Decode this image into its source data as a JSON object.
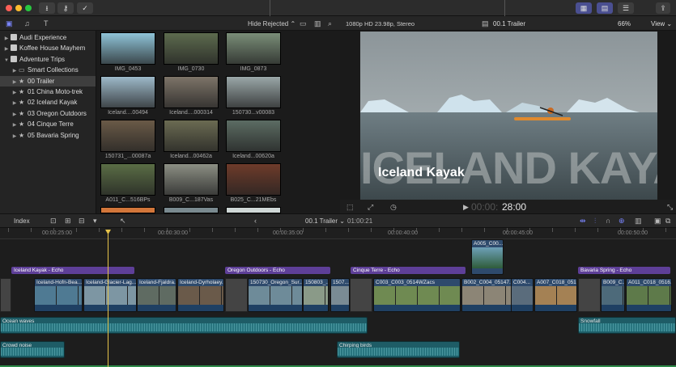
{
  "window": {
    "traffic": [
      "close",
      "minimize",
      "zoom"
    ]
  },
  "toolbar": {
    "hide_rejected": "Hide Rejected ⌃",
    "format": "1080p HD 23.98p, Stereo",
    "clip_name": "00.1 Trailer",
    "zoom": "66%",
    "view": "View ⌄"
  },
  "libraries": [
    {
      "label": "Audi Experience",
      "kind": "lib",
      "indent": 0
    },
    {
      "label": "Koffee House Mayhem",
      "kind": "lib",
      "indent": 0
    },
    {
      "label": "Adventure Trips",
      "kind": "lib",
      "indent": 0,
      "open": true
    },
    {
      "label": "Smart Collections",
      "kind": "folder",
      "indent": 1
    },
    {
      "label": "00 Trailer",
      "kind": "event",
      "indent": 1,
      "selected": true
    },
    {
      "label": "01 China Moto-trek",
      "kind": "event",
      "indent": 1
    },
    {
      "label": "02 Iceland Kayak",
      "kind": "event",
      "indent": 1
    },
    {
      "label": "03 Oregon Outdoors",
      "kind": "event",
      "indent": 1
    },
    {
      "label": "04 Cinque Terre",
      "kind": "event",
      "indent": 1
    },
    {
      "label": "05 Bavaria Spring",
      "kind": "event",
      "indent": 1
    }
  ],
  "browser": {
    "clips": [
      {
        "label": "IMG_0453",
        "bg": "#8fc4d8"
      },
      {
        "label": "IMG_0730",
        "bg": "#5d6b4e"
      },
      {
        "label": "IMG_0873",
        "bg": "#7a8e78"
      },
      {
        "label": "Iceland....00494",
        "bg": "#9db9c9"
      },
      {
        "label": "Iceland....000314",
        "bg": "#7d7468"
      },
      {
        "label": "150730...v00083",
        "bg": "#9aa7a8"
      },
      {
        "label": "150731_...00087a",
        "bg": "#6a5a47"
      },
      {
        "label": "Iceland...00462a",
        "bg": "#6b6b52"
      },
      {
        "label": "Iceland...00620a",
        "bg": "#5c6c63"
      },
      {
        "label": "A011_C...516BPs",
        "bg": "#5a6d45"
      },
      {
        "label": "B009_C...187Vas",
        "bg": "#8c8f84"
      },
      {
        "label": "B025_C...21MEbs",
        "bg": "#6e3b2a"
      }
    ]
  },
  "viewer": {
    "overlay_title": "Iceland Kayak",
    "bg_title": "ICELAND KAYAK",
    "timecode": "28:00",
    "timecode_prefix": "00:00:"
  },
  "timeline": {
    "index_label": "Index",
    "project": "00.1 Trailer ⌄",
    "duration": "01:00:21",
    "ruler": [
      "00:00:25:00",
      "00:00:30:00",
      "00:00:35:00",
      "00:00:40:00",
      "00:00:45:00",
      "00:00:50:00"
    ],
    "titles": [
      "Iceland Kayak - Echo",
      "Oregon Outdoors - Echo",
      "Cinque Terre - Echo",
      "Bavaria Spring - Echo"
    ],
    "clips": [
      "Iceland-Hofn-Bea...",
      "Iceland-Glacier-Lag...",
      "Iceland-Fjaldra...",
      "Iceland-Dyrholaey...",
      "150730_Oregon_Sur...",
      "150803_...",
      "1507...",
      "C003_C003_0514WZacs",
      "B002_C004_05147...",
      "C004...",
      "A007_C018_051...",
      "B009_C...",
      "A011_C018_0516..."
    ],
    "connected": "A005_C00...",
    "audio": [
      "Ocean waves",
      "Snowfall",
      "Crowd noise",
      "Chirping birds"
    ]
  }
}
